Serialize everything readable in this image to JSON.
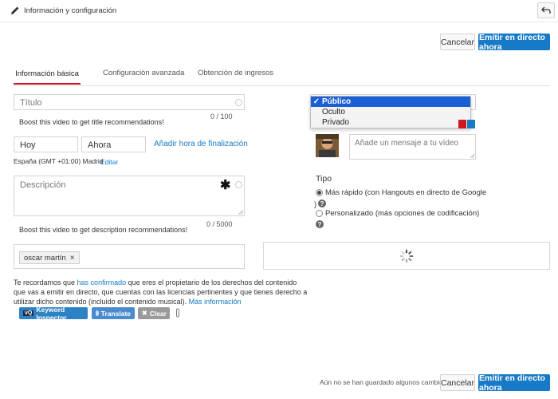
{
  "header": {
    "title": "Información y configuración",
    "back_icon": "back-arrow-icon"
  },
  "actions_top": {
    "cancel_label": "Cancelar",
    "stream_label": "Emitir en directo ahora"
  },
  "tabs": [
    {
      "label": "Información básica",
      "active": true
    },
    {
      "label": "Configuración avanzada",
      "active": false
    },
    {
      "label": "Obtención de ingresos",
      "active": false
    }
  ],
  "title_field": {
    "placeholder": "Título",
    "counter": "0 / 100",
    "hint": "Boost this video to get title recommendations!"
  },
  "schedule": {
    "date": "Hoy",
    "time": "Ahora",
    "add_end_link": "Añadir hora de finalización",
    "timezone": "España (GMT +01:00) Madrid",
    "edit_link": "Editar"
  },
  "description_field": {
    "placeholder": "Descripción",
    "counter": "0 / 5000",
    "hint": "Boost this video to get description recommendations!"
  },
  "tags": {
    "chip_label": "oscar martín",
    "remove": "×"
  },
  "notice": {
    "part1": "Te recordamos que ",
    "link1": "has confirmado",
    "part2": " que eres el propietario de los derechos del contenido que vas a emitir en directo, que cuentas con las licencias pertinentes y que tienes derecho a utilizar dicho contenido (incluido el contenido musical). ",
    "link2": "Más información"
  },
  "extensions": {
    "keyword_label": "Keyword Inspector",
    "translate_label": "Translate",
    "clear_label": "Clear",
    "vq_badge": "vQ"
  },
  "privacy": {
    "options": [
      "Público",
      "Oculto",
      "Privado"
    ],
    "selected": "Público",
    "check": "✓"
  },
  "share": {
    "placeholder": "Añade un mensaje a tu vídeo"
  },
  "tipo": {
    "label": "Tipo",
    "option1_line1": "Más rápido (con Hangouts en directo de Google",
    "option1_line2": ")",
    "option2": "Personalizado (más opciones de codificación)",
    "help": "?"
  },
  "footer": {
    "status": "Aún no se han guardado algunos cambios.",
    "cancel_label": "Cancelar",
    "stream_label": "Emitir en directo ahora"
  },
  "colors": {
    "accent_blue": "#167ac6",
    "tab_underline": "#cc181e",
    "dropdown_highlight": "#1a5fd6",
    "keyword_btn": "#2d82c3",
    "translate_btn": "#4a8bd0",
    "clear_btn": "#9a9a9a"
  }
}
